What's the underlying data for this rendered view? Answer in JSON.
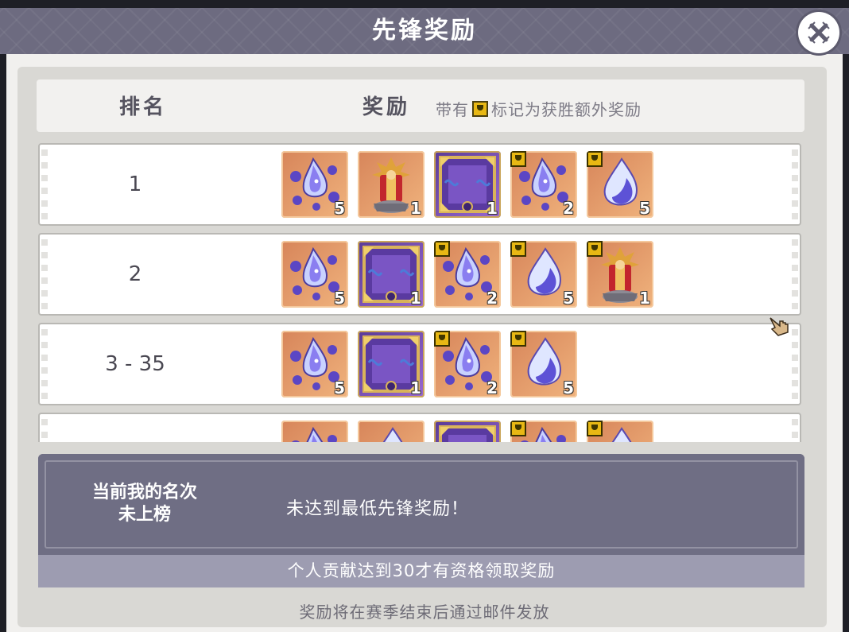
{
  "title": "先锋奖励",
  "close_icon": "close-x-icon",
  "header": {
    "rank_label": "排名",
    "reward_label": "奖励",
    "note_prefix": "带有",
    "note_suffix": "标记为获胜额外奖励"
  },
  "rows": [
    {
      "rank": "1",
      "items": [
        {
          "type": "crystal-cluster",
          "qty": "5",
          "bonus": false
        },
        {
          "type": "statue",
          "qty": "1",
          "bonus": false
        },
        {
          "type": "frame",
          "qty": "1",
          "bonus": false
        },
        {
          "type": "crystal-cluster",
          "qty": "2",
          "bonus": true
        },
        {
          "type": "crystal-drop",
          "qty": "5",
          "bonus": true
        }
      ]
    },
    {
      "rank": "2",
      "items": [
        {
          "type": "crystal-cluster",
          "qty": "5",
          "bonus": false
        },
        {
          "type": "frame",
          "qty": "1",
          "bonus": false
        },
        {
          "type": "crystal-cluster",
          "qty": "2",
          "bonus": true
        },
        {
          "type": "crystal-drop",
          "qty": "5",
          "bonus": true
        },
        {
          "type": "statue",
          "qty": "1",
          "bonus": true
        }
      ]
    },
    {
      "rank": "3 - 35",
      "items": [
        {
          "type": "crystal-cluster",
          "qty": "5",
          "bonus": false
        },
        {
          "type": "frame",
          "qty": "1",
          "bonus": false
        },
        {
          "type": "crystal-cluster",
          "qty": "2",
          "bonus": true
        },
        {
          "type": "crystal-drop",
          "qty": "5",
          "bonus": true
        }
      ]
    },
    {
      "rank": "",
      "items": [
        {
          "type": "crystal-cluster",
          "qty": "",
          "bonus": false
        },
        {
          "type": "crystal-drop",
          "qty": "",
          "bonus": false
        },
        {
          "type": "frame",
          "qty": "",
          "bonus": false
        },
        {
          "type": "crystal-cluster",
          "qty": "",
          "bonus": true
        },
        {
          "type": "crystal-drop",
          "qty": "",
          "bonus": true
        }
      ]
    }
  ],
  "my_rank": {
    "label_line1": "当前我的名次",
    "label_line2": "未上榜",
    "message": "未达到最低先锋奖励！",
    "requirement": "个人贡献达到30才有资格领取奖励"
  },
  "footer": "奖励将在赛季结束后通过邮件发放",
  "colors": {
    "titlebar": "#6d6b80",
    "item_orange": "#e39a6a",
    "item_purple": "#6b46a8",
    "trophy_gold": "#e8b814"
  }
}
